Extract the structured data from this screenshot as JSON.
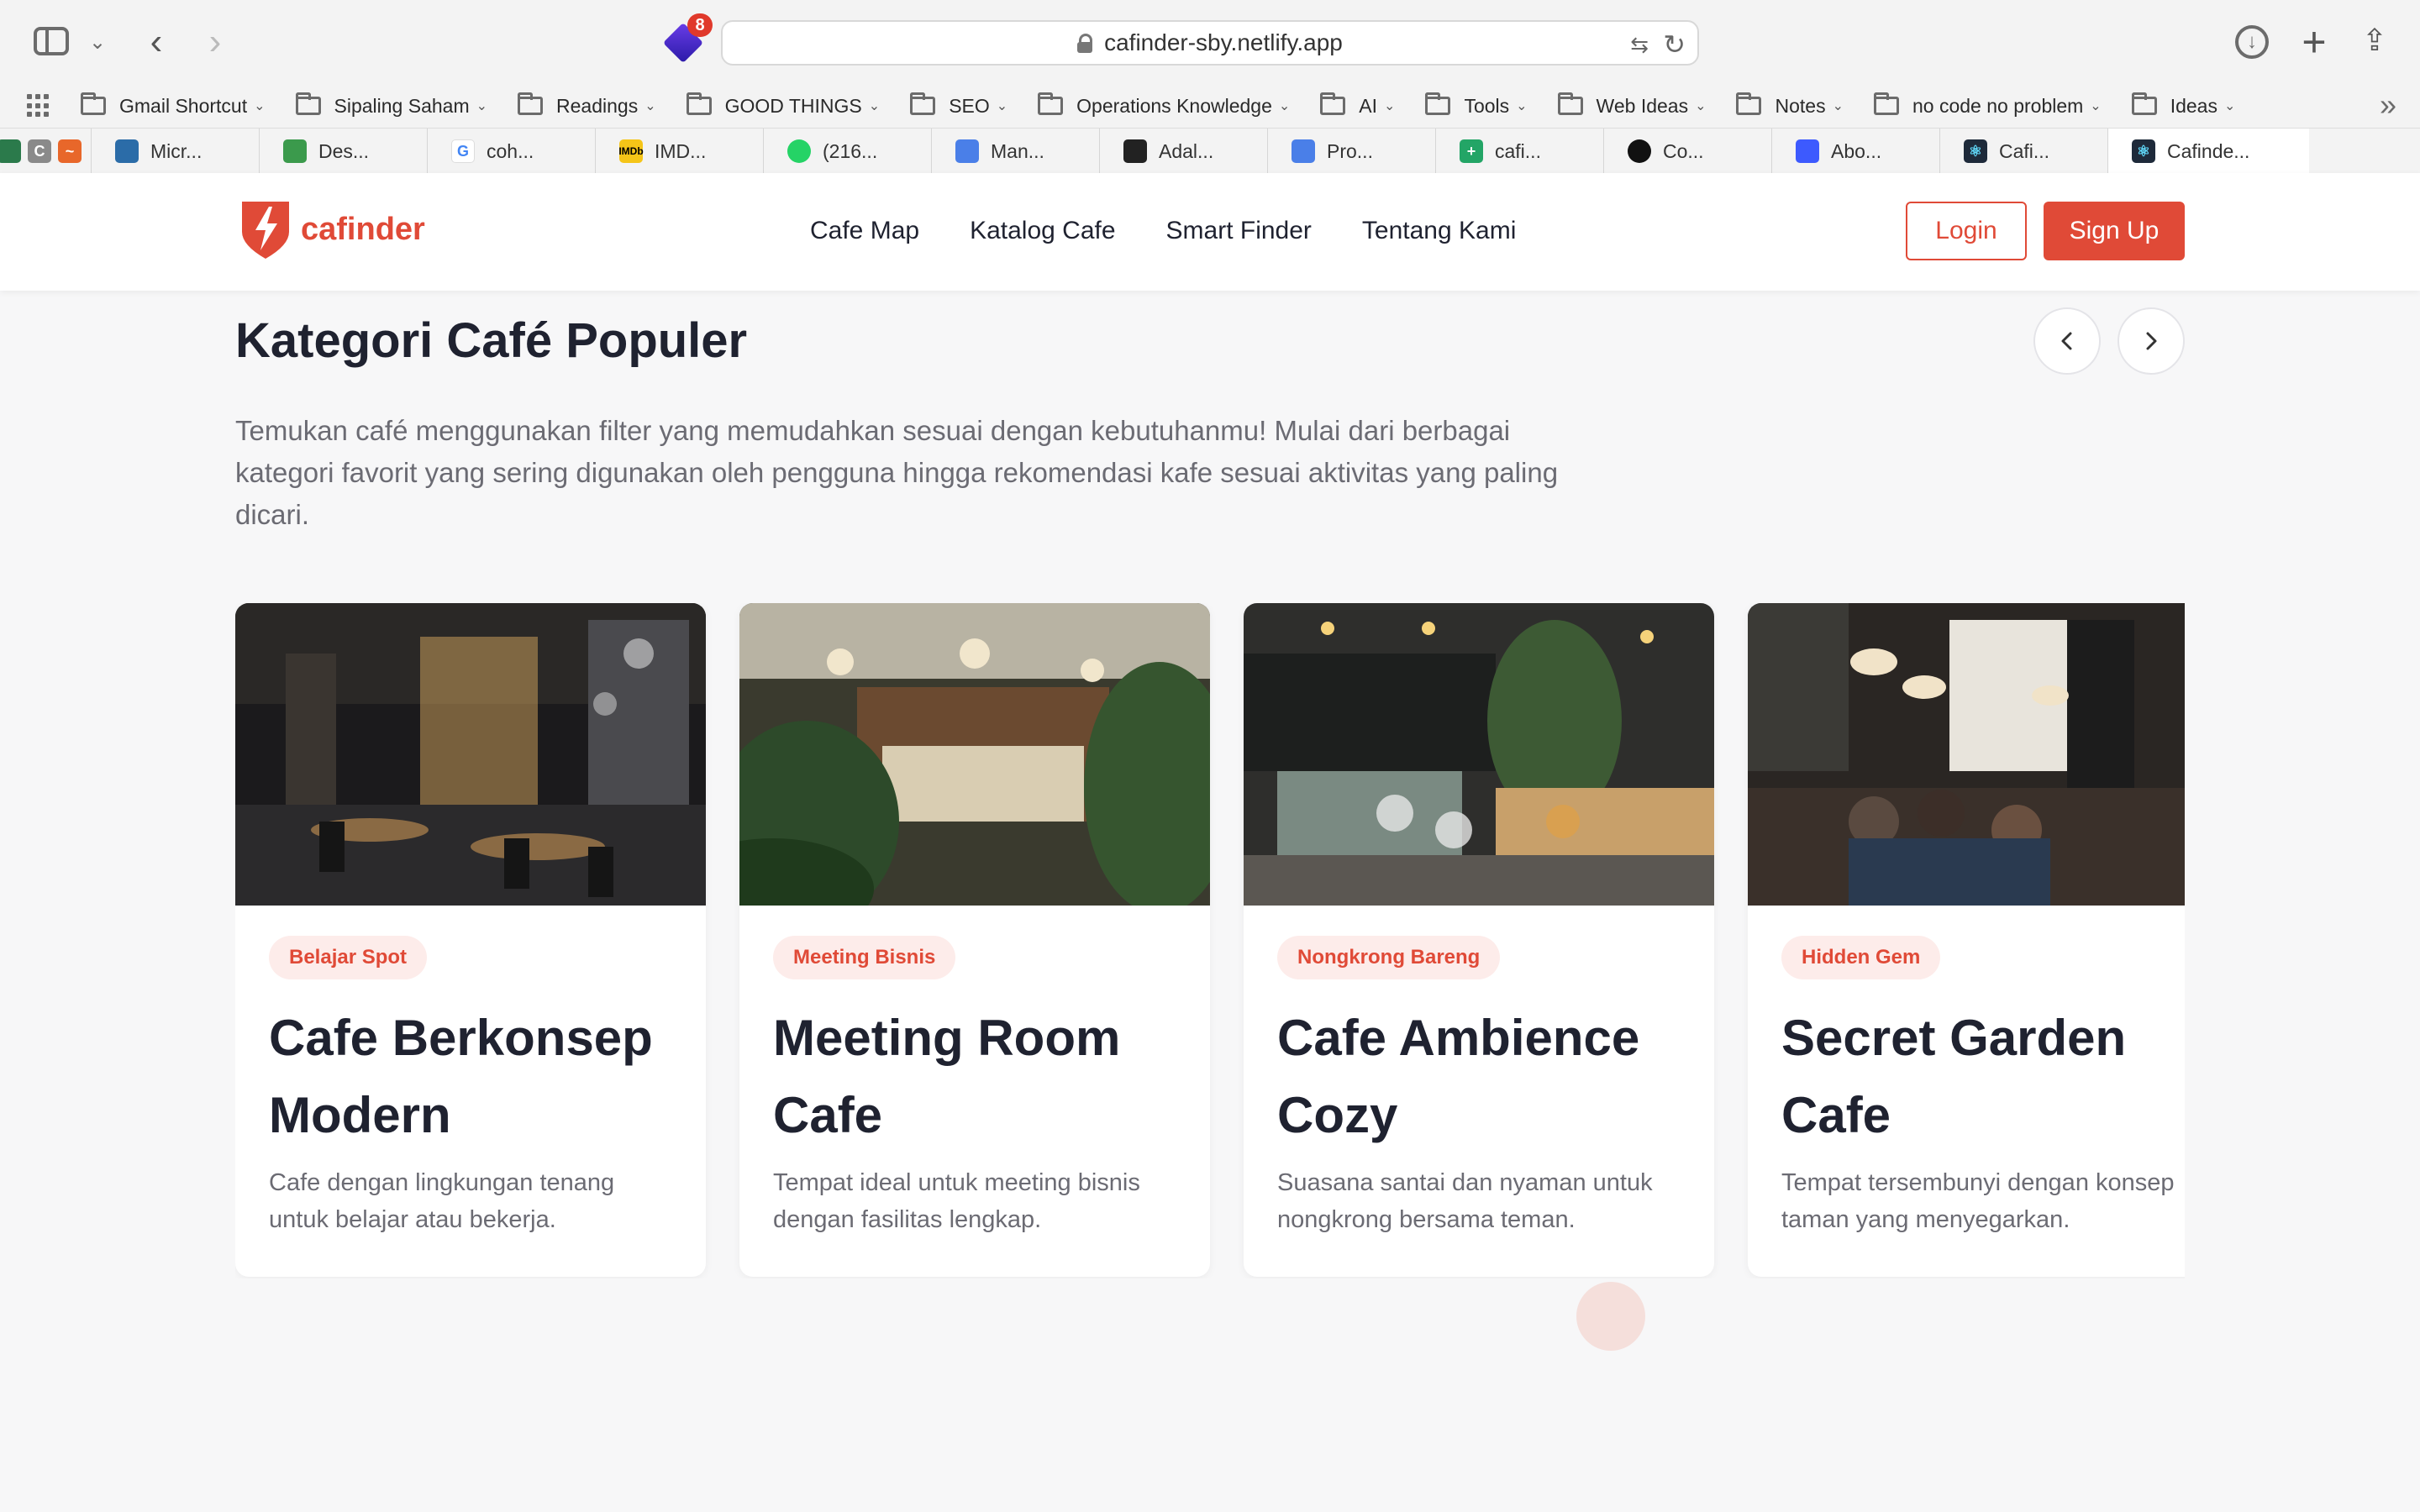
{
  "browser": {
    "url": "cafinder-sby.netlify.app",
    "extension_badge": "8",
    "bookmarks": [
      "Gmail Shortcut",
      "Sipaling Saham",
      "Readings",
      "GOOD THINGS",
      "SEO",
      "Operations Knowledge",
      "AI",
      "Tools",
      "Web Ideas",
      "Notes",
      "no code no problem",
      "Ideas"
    ],
    "tabs": [
      "Micr...",
      "Des...",
      "coh...",
      "IMD...",
      "(216...",
      "Man...",
      "Adal...",
      "Pro...",
      "cafi...",
      "Co...",
      "Abo...",
      "Cafi...",
      "Cafinde..."
    ],
    "pinned_tab_letter": "C"
  },
  "header": {
    "logo_text": "cafinder",
    "nav": [
      "Cafe Map",
      "Katalog Cafe",
      "Smart Finder",
      "Tentang Kami"
    ],
    "login_label": "Login",
    "signup_label": "Sign Up"
  },
  "section": {
    "title": "Kategori Café Populer",
    "description": "Temukan café menggunakan filter yang memudahkan sesuai dengan kebutuhanmu! Mulai dari berbagai kategori favorit yang sering digunakan oleh pengguna hingga rekomendasi kafe sesuai aktivitas yang paling dicari.",
    "prev_icon": "chevron-left-icon",
    "next_icon": "chevron-right-icon"
  },
  "cards": [
    {
      "tag": "Belajar Spot",
      "title": "Cafe Berkonsep Modern",
      "desc": "Cafe dengan lingkungan tenang untuk belajar atau bekerja."
    },
    {
      "tag": "Meeting Bisnis",
      "title": "Meeting Room Cafe",
      "desc": "Tempat ideal untuk meeting bisnis dengan fasilitas lengkap."
    },
    {
      "tag": "Nongkrong Bareng",
      "title": "Cafe Ambience Cozy",
      "desc": "Suasana santai dan nyaman untuk nongkrong bersama teman."
    },
    {
      "tag": "Hidden Gem",
      "title": "Secret Garden Cafe",
      "desc": "Tempat tersembunyi dengan konsep taman yang menyegarkan."
    }
  ],
  "colors": {
    "brand": "#e04a37",
    "tag_bg": "#fdecea",
    "page_bg": "#f7f7f8",
    "text_dark": "#1f2230",
    "text_muted": "#6b6b73"
  }
}
